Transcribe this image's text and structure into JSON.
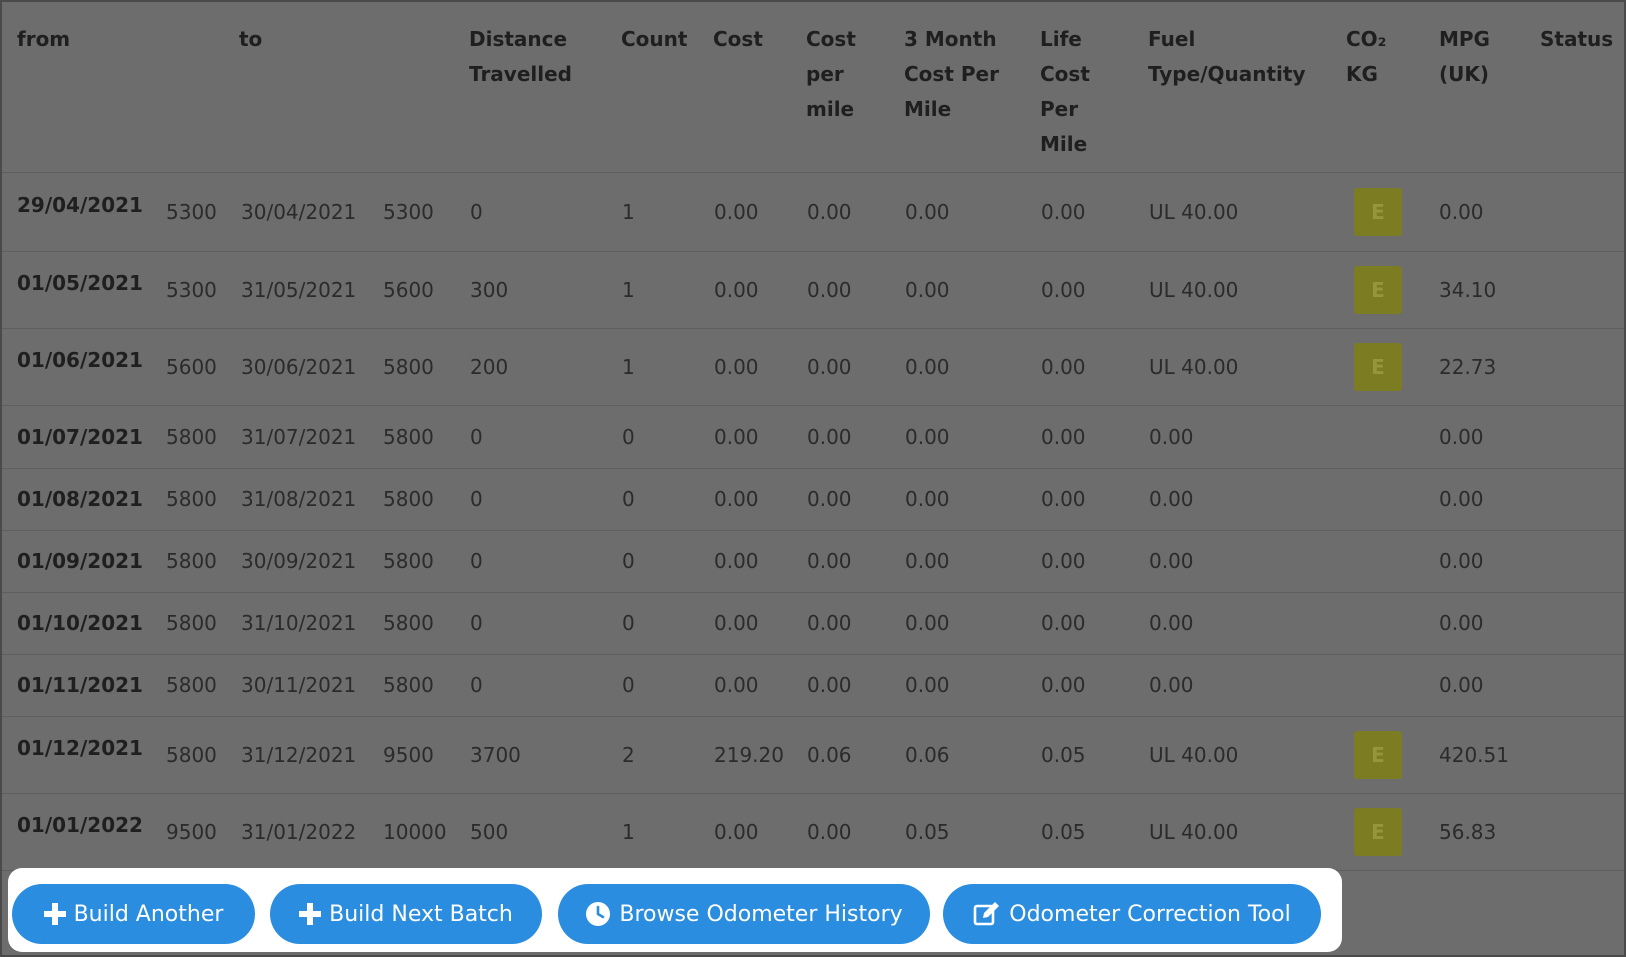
{
  "columns": [
    {
      "label": "from"
    },
    {
      "label": "to"
    },
    {
      "label": "Distance\nTravelled"
    },
    {
      "label": "Count"
    },
    {
      "label": "Cost"
    },
    {
      "label": "Cost\nper\nmile"
    },
    {
      "label": "3 Month\nCost Per\nMile"
    },
    {
      "label": "Life\nCost\nPer\nMile"
    },
    {
      "label": "Fuel\nType/Quantity"
    },
    {
      "label": "CO₂\nKG"
    },
    {
      "label": "MPG\n(UK)"
    },
    {
      "label": "Status"
    }
  ],
  "rows": [
    {
      "from_date": "29/04/2021",
      "from_odo": "5300",
      "to_date": "30/04/2021",
      "to_odo": "5300",
      "distance": "0",
      "count": "1",
      "cost": "0.00",
      "cost_per_mile": "0.00",
      "three_month": "0.00",
      "life_cost": "0.00",
      "fuel": "UL 40.00",
      "co2": "E",
      "mpg": "0.00"
    },
    {
      "from_date": "01/05/2021",
      "from_odo": "5300",
      "to_date": "31/05/2021",
      "to_odo": "5600",
      "distance": "300",
      "count": "1",
      "cost": "0.00",
      "cost_per_mile": "0.00",
      "three_month": "0.00",
      "life_cost": "0.00",
      "fuel": "UL 40.00",
      "co2": "E",
      "mpg": "34.10"
    },
    {
      "from_date": "01/06/2021",
      "from_odo": "5600",
      "to_date": "30/06/2021",
      "to_odo": "5800",
      "distance": "200",
      "count": "1",
      "cost": "0.00",
      "cost_per_mile": "0.00",
      "three_month": "0.00",
      "life_cost": "0.00",
      "fuel": "UL 40.00",
      "co2": "E",
      "mpg": "22.73"
    },
    {
      "from_date": "01/07/2021",
      "from_odo": "5800",
      "to_date": "31/07/2021",
      "to_odo": "5800",
      "distance": "0",
      "count": "0",
      "cost": "0.00",
      "cost_per_mile": "0.00",
      "three_month": "0.00",
      "life_cost": "0.00",
      "fuel": "0.00",
      "co2": "",
      "mpg": "0.00"
    },
    {
      "from_date": "01/08/2021",
      "from_odo": "5800",
      "to_date": "31/08/2021",
      "to_odo": "5800",
      "distance": "0",
      "count": "0",
      "cost": "0.00",
      "cost_per_mile": "0.00",
      "three_month": "0.00",
      "life_cost": "0.00",
      "fuel": "0.00",
      "co2": "",
      "mpg": "0.00"
    },
    {
      "from_date": "01/09/2021",
      "from_odo": "5800",
      "to_date": "30/09/2021",
      "to_odo": "5800",
      "distance": "0",
      "count": "0",
      "cost": "0.00",
      "cost_per_mile": "0.00",
      "three_month": "0.00",
      "life_cost": "0.00",
      "fuel": "0.00",
      "co2": "",
      "mpg": "0.00"
    },
    {
      "from_date": "01/10/2021",
      "from_odo": "5800",
      "to_date": "31/10/2021",
      "to_odo": "5800",
      "distance": "0",
      "count": "0",
      "cost": "0.00",
      "cost_per_mile": "0.00",
      "three_month": "0.00",
      "life_cost": "0.00",
      "fuel": "0.00",
      "co2": "",
      "mpg": "0.00"
    },
    {
      "from_date": "01/11/2021",
      "from_odo": "5800",
      "to_date": "30/11/2021",
      "to_odo": "5800",
      "distance": "0",
      "count": "0",
      "cost": "0.00",
      "cost_per_mile": "0.00",
      "three_month": "0.00",
      "life_cost": "0.00",
      "fuel": "0.00",
      "co2": "",
      "mpg": "0.00"
    },
    {
      "from_date": "01/12/2021",
      "from_odo": "5800",
      "to_date": "31/12/2021",
      "to_odo": "9500",
      "distance": "3700",
      "count": "2",
      "cost": "219.20",
      "cost_per_mile": "0.06",
      "three_month": "0.06",
      "life_cost": "0.05",
      "fuel": "UL 40.00",
      "co2": "E",
      "mpg": "420.51"
    },
    {
      "from_date": "01/01/2022",
      "from_odo": "9500",
      "to_date": "31/01/2022",
      "to_odo": "10000",
      "distance": "500",
      "count": "1",
      "cost": "0.00",
      "cost_per_mile": "0.00",
      "three_month": "0.05",
      "life_cost": "0.05",
      "fuel": "UL 40.00",
      "co2": "E",
      "mpg": "56.83"
    }
  ],
  "actions": [
    {
      "label": "Build Another",
      "icon": "plus-icon"
    },
    {
      "label": "Build Next Batch",
      "icon": "plus-icon"
    },
    {
      "label": "Browse Odometer History",
      "icon": "clock-icon"
    },
    {
      "label": "Odometer Correction Tool",
      "icon": "edit-icon"
    }
  ],
  "colors": {
    "overlay": "#6d6d6d",
    "badge": "#7c7c22",
    "button": "#2a8de0",
    "footer": "#ffffff"
  }
}
